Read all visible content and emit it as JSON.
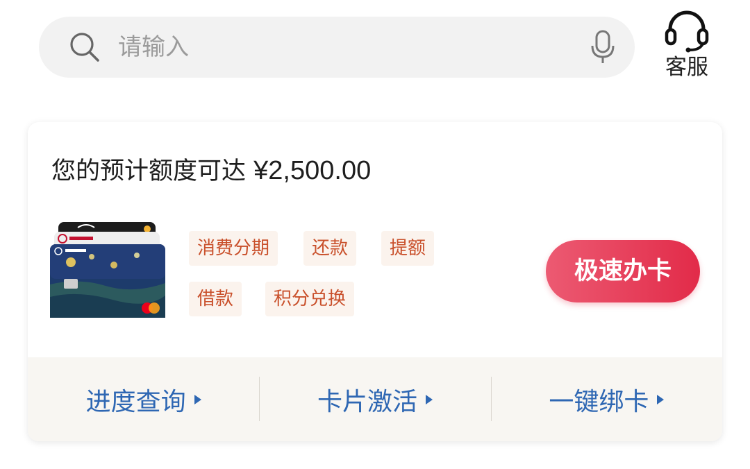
{
  "search": {
    "placeholder": "请输入"
  },
  "service": {
    "label": "客服"
  },
  "credit": {
    "prefix": "您的预计额度可达",
    "amount": "¥2,500.00"
  },
  "tags": [
    "消费分期",
    "还款",
    "提额",
    "借款",
    "积分兑换"
  ],
  "apply_button": "极速办卡",
  "actions": [
    "进度查询",
    "卡片激活",
    "一键绑卡"
  ],
  "colors": {
    "accent": "#e22b49",
    "link": "#2e67b3",
    "tag_text": "#c9502b",
    "tag_bg": "#fbf3ed"
  }
}
